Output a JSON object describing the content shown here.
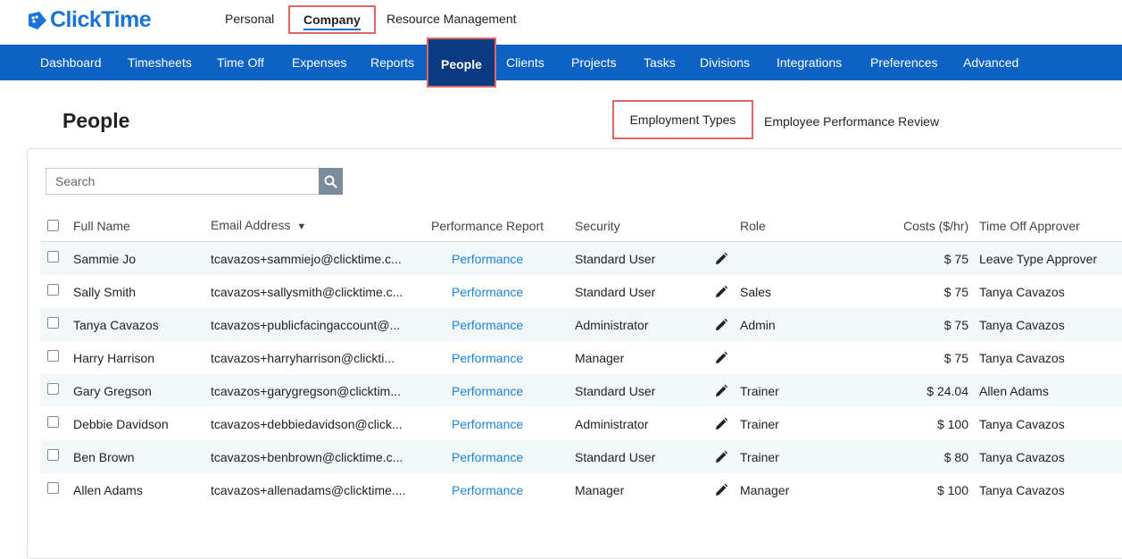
{
  "brand": {
    "name": "ClickTime",
    "color": "#1a73d8"
  },
  "top_tabs": {
    "personal": "Personal",
    "company": "Company",
    "resource_management": "Resource Management"
  },
  "nav": [
    "Dashboard",
    "Timesheets",
    "Time Off",
    "Expenses",
    "Reports",
    "People",
    "Clients",
    "Projects",
    "Tasks",
    "Divisions",
    "Integrations",
    "Preferences",
    "Advanced"
  ],
  "page": {
    "title": "People",
    "subtabs": {
      "employment_types": "Employment Types",
      "performance_review": "Employee Performance Review"
    }
  },
  "search": {
    "placeholder": "Search",
    "icon": "search-icon"
  },
  "table": {
    "headers": {
      "full_name": "Full Name",
      "email": "Email Address",
      "sort_indicator": "▼",
      "performance": "Performance Report",
      "security": "Security",
      "role": "Role",
      "costs": "Costs ($/hr)",
      "approver": "Time Off Approver"
    },
    "rows": [
      {
        "name": "Sammie Jo",
        "email": "tcavazos+sammiejo@clicktime.c...",
        "performance": "Performance",
        "security": "Standard User",
        "role": "",
        "cost": "$ 75",
        "approver": "Leave Type Approver"
      },
      {
        "name": "Sally Smith",
        "email": "tcavazos+sallysmith@clicktime.c...",
        "performance": "Performance",
        "security": "Standard User",
        "role": "Sales",
        "cost": "$ 75",
        "approver": "Tanya Cavazos"
      },
      {
        "name": "Tanya Cavazos",
        "email": "tcavazos+publicfacingaccount@...",
        "performance": "Performance",
        "security": "Administrator",
        "role": "Admin",
        "cost": "$ 75",
        "approver": "Tanya Cavazos"
      },
      {
        "name": "Harry Harrison",
        "email": "tcavazos+harryharrison@clickti...",
        "performance": "Performance",
        "security": "Manager",
        "role": "",
        "cost": "$ 75",
        "approver": "Tanya Cavazos"
      },
      {
        "name": "Gary Gregson",
        "email": "tcavazos+garygregson@clicktim...",
        "performance": "Performance",
        "security": "Standard User",
        "role": "Trainer",
        "cost": "$ 24.04",
        "approver": "Allen Adams"
      },
      {
        "name": "Debbie Davidson",
        "email": "tcavazos+debbiedavidson@click...",
        "performance": "Performance",
        "security": "Administrator",
        "role": "Trainer",
        "cost": "$ 100",
        "approver": "Tanya Cavazos"
      },
      {
        "name": "Ben Brown",
        "email": "tcavazos+benbrown@clicktime.c...",
        "performance": "Performance",
        "security": "Standard User",
        "role": "Trainer",
        "cost": "$ 80",
        "approver": "Tanya Cavazos"
      },
      {
        "name": "Allen Adams",
        "email": "tcavazos+allenadams@clicktime....",
        "performance": "Performance",
        "security": "Manager",
        "role": "Manager",
        "cost": "$ 100",
        "approver": "Tanya Cavazos"
      }
    ]
  },
  "colors": {
    "nav_bg": "#0d62c4",
    "nav_active": "#0b3a80",
    "link": "#1a84d8",
    "highlight_box": "#e06666"
  }
}
